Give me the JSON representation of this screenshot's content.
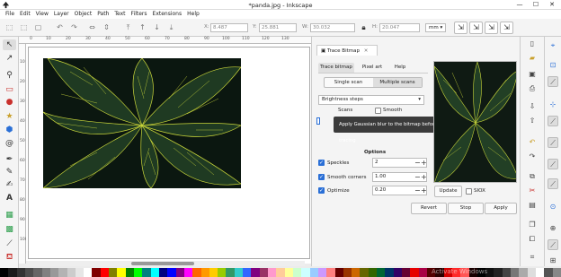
{
  "window": {
    "title": "*panda.jpg - Inkscape",
    "controls": {
      "minimize": "—",
      "maximize": "☐",
      "close": "✕"
    }
  },
  "menu": [
    "File",
    "Edit",
    "View",
    "Layer",
    "Object",
    "Path",
    "Text",
    "Filters",
    "Extensions",
    "Help"
  ],
  "toolbar": {
    "x_label": "X:",
    "x_value": "8.487",
    "y_label": "Y:",
    "y_value": "25.881",
    "w_label": "W:",
    "w_value": "30.032",
    "h_label": "H:",
    "h_value": "20.047",
    "unit": "mm"
  },
  "rulers": {
    "horizontal": [
      "0",
      "10",
      "20",
      "30",
      "40",
      "50",
      "60",
      "70",
      "80",
      "90",
      "100",
      "110",
      "120",
      "130"
    ],
    "vertical": [
      "10",
      "20",
      "30",
      "40",
      "50",
      "60",
      "70",
      "80",
      "90",
      "100"
    ]
  },
  "dialog": {
    "tab_title": "Trace Bitmap",
    "tab_close": "✕",
    "tabs": [
      "Trace bitmap",
      "Pixel art",
      "Help"
    ],
    "modes": [
      "Single scan",
      "Multiple scans"
    ],
    "method": "Brightness steps",
    "scans_label": "Scans",
    "smooth_label": "Smooth",
    "tooltip": "Apply Gaussian blur to the bitmap before tracing",
    "options_heading": "Options",
    "options": [
      {
        "label": "Speckles",
        "value": "2",
        "checked": true
      },
      {
        "label": "Smooth corners",
        "value": "1.00",
        "checked": true
      },
      {
        "label": "Optimize",
        "value": "0.20",
        "checked": true
      }
    ],
    "update_label": "Update",
    "siox_label": "SIOX",
    "revert_label": "Revert",
    "stop_label": "Stop",
    "apply_label": "Apply"
  },
  "status": {
    "watermark": "Activate Windows"
  },
  "colors": {
    "leaf_dark": "#0b1710",
    "vein_yellow": "#c9d63a",
    "accent_blue": "#2a6fd6"
  },
  "palette": [
    "#000000",
    "#1a1a1a",
    "#333333",
    "#4d4d4d",
    "#666666",
    "#808080",
    "#999999",
    "#b3b3b3",
    "#cccccc",
    "#e6e6e6",
    "#ffffff",
    "#800000",
    "#ff0000",
    "#808000",
    "#ffff00",
    "#008000",
    "#00ff00",
    "#008080",
    "#00ffff",
    "#000080",
    "#0000ff",
    "#800080",
    "#ff00ff",
    "#ff6600",
    "#ff9900",
    "#ffcc00",
    "#99cc00",
    "#339966",
    "#33cccc",
    "#3366ff",
    "#800080",
    "#993366",
    "#ff99cc",
    "#ffcc99",
    "#ffff99",
    "#ccffcc",
    "#ccffff",
    "#99ccff",
    "#cc99ff",
    "#ff8080",
    "#660000",
    "#993300",
    "#cc6600",
    "#666600",
    "#336600",
    "#006633",
    "#003366",
    "#330066",
    "#660033",
    "#e60000",
    "#aa0044",
    "#550000",
    "#2b0000",
    "#d40000",
    "#ff2a2a",
    "#ff5555",
    "#1a0000",
    "#000000",
    "#111111",
    "#222222",
    "#444444",
    "#777777",
    "#aaaaaa",
    "#dddddd",
    "#ffffff",
    "#555555",
    "#888888"
  ]
}
